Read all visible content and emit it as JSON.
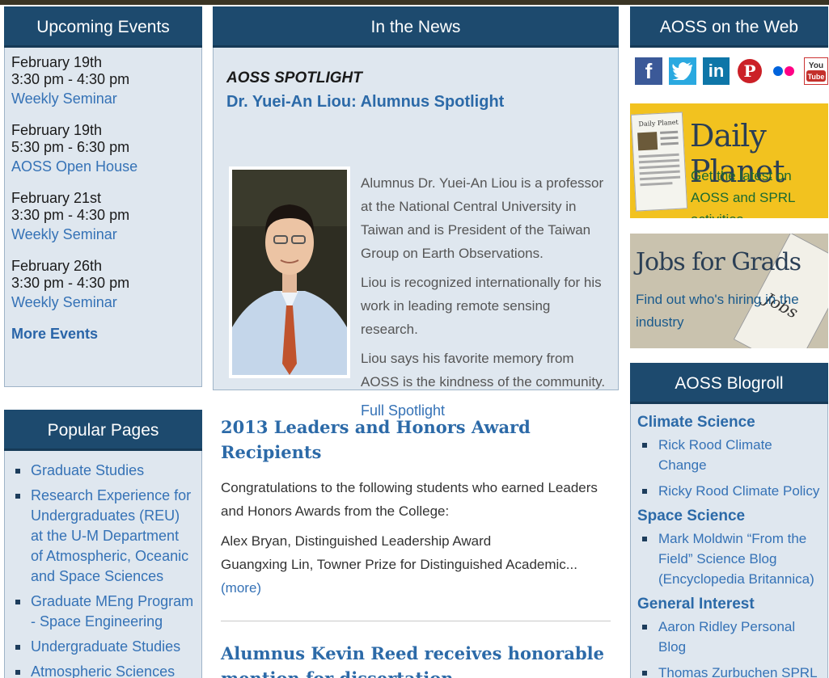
{
  "upcoming_events": {
    "title": "Upcoming Events",
    "items": [
      {
        "date": "February 19th",
        "time": "3:30 pm - 4:30 pm",
        "name": "Weekly Seminar"
      },
      {
        "date": "February 19th",
        "time": "5:30 pm - 6:30 pm",
        "name": "AOSS Open House"
      },
      {
        "date": "February 21st",
        "time": "3:30 pm - 4:30 pm",
        "name": "Weekly Seminar"
      },
      {
        "date": "February 26th",
        "time": "3:30 pm - 4:30 pm",
        "name": "Weekly Seminar"
      }
    ],
    "more_link": "More Events"
  },
  "popular_pages": {
    "title": "Popular Pages",
    "items": [
      "Graduate Studies",
      "Research Experience for Undergraduates (REU) at the U-M Department of Atmospheric, Oceanic and Space Sciences",
      "Graduate MEng Program - Space Engineering",
      "Undergraduate Studies",
      "Atmospheric Sciences"
    ]
  },
  "news": {
    "title": "In the News",
    "spotlight": {
      "kicker": "AOSS SPOTLIGHT",
      "headline": "Dr. Yuei-An Liou: Alumnus Spotlight",
      "paragraphs": [
        "Alumnus Dr. Yuei-An Liou is a professor at the National Central University in Taiwan and is President of the Taiwan Group on Earth Observations.",
        "Liou is recognized internationally for his work in leading remote sensing research.",
        "Liou says his favorite memory from AOSS is the kindness of the community."
      ],
      "link": "Full Spotlight"
    },
    "articles": [
      {
        "title": "2013 Leaders and Honors Award Recipients",
        "intro": "Congratulations to the following students who earned Leaders and Honors Awards from the College:",
        "line1": "Alex Bryan, Distinguished Leadership Award",
        "line2": "Guangxing Lin, Towner Prize for Distinguished Academic...",
        "more": "(more)"
      },
      {
        "title": "Alumnus Kevin Reed receives honorable mention for dissertation"
      }
    ]
  },
  "web": {
    "title": "AOSS on the Web",
    "social": [
      {
        "icon": "facebook-icon",
        "glyph": "f"
      },
      {
        "icon": "twitter-icon",
        "glyph": "t"
      },
      {
        "icon": "linkedin-icon",
        "glyph": "in"
      },
      {
        "icon": "pinterest-icon",
        "glyph": "P"
      },
      {
        "icon": "flickr-icon",
        "glyph": "••"
      },
      {
        "icon": "youtube-icon",
        "glyph": "You Tube"
      }
    ],
    "daily_planet": {
      "title": "Daily Planet",
      "subtitle": "Get the latest on AOSS and SPRL activities",
      "paper_label": "Daily Planet"
    },
    "jobs": {
      "title": "Jobs for Grads",
      "subtitle": "Find out who's hiring in the industry",
      "paper_label": "Jobs"
    }
  },
  "blogroll": {
    "title": "AOSS Blogroll",
    "categories": [
      {
        "name": "Climate Science",
        "items": [
          "Rick Rood Climate Change",
          "Ricky Rood Climate Policy"
        ]
      },
      {
        "name": "Space Science",
        "items": [
          "Mark Moldwin “From the Field” Science Blog (Encyclopedia Britannica)"
        ]
      },
      {
        "name": "General Interest",
        "items": [
          "Aaron Ridley Personal Blog",
          "Thomas Zurbuchen SPRL"
        ]
      }
    ]
  },
  "colors": {
    "header_bg": "#1d4a6e",
    "panel_bg": "#dfe7ef",
    "link": "#3572b6",
    "daily_planet_bg": "#f2c21f"
  }
}
